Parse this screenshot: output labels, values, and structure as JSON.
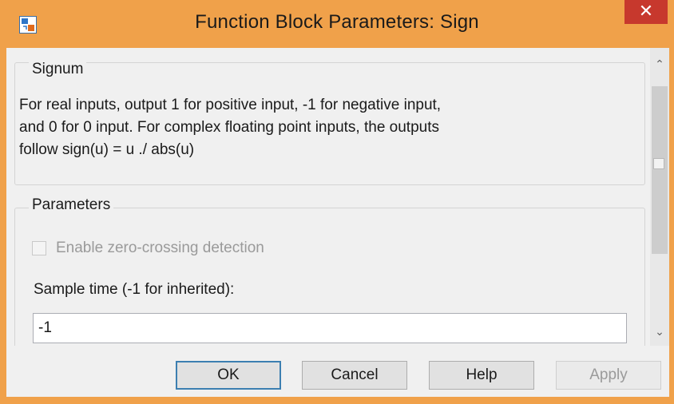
{
  "window": {
    "title": "Function Block Parameters: Sign",
    "close_glyph": "✕",
    "icon": "simulink-block-icon",
    "frame_color": "#f0a14a",
    "close_color": "#c7382d"
  },
  "signum": {
    "group_title": "Signum",
    "description": "For real inputs, output 1 for positive input, -1 for negative input,\nand 0 for 0 input.  For complex floating point inputs, the outputs\nfollow sign(u) = u ./ abs(u)"
  },
  "parameters": {
    "group_title": "Parameters",
    "zero_crossing_label": "Enable zero-crossing detection",
    "zero_crossing_checked": false,
    "zero_crossing_enabled": false,
    "sample_time_label": "Sample time (-1 for inherited):",
    "sample_time_value": "-1"
  },
  "scrollbar": {
    "up_glyph": "⌃",
    "down_glyph": "⌄"
  },
  "buttons": {
    "ok": "OK",
    "cancel": "Cancel",
    "help": "Help",
    "apply": "Apply"
  }
}
